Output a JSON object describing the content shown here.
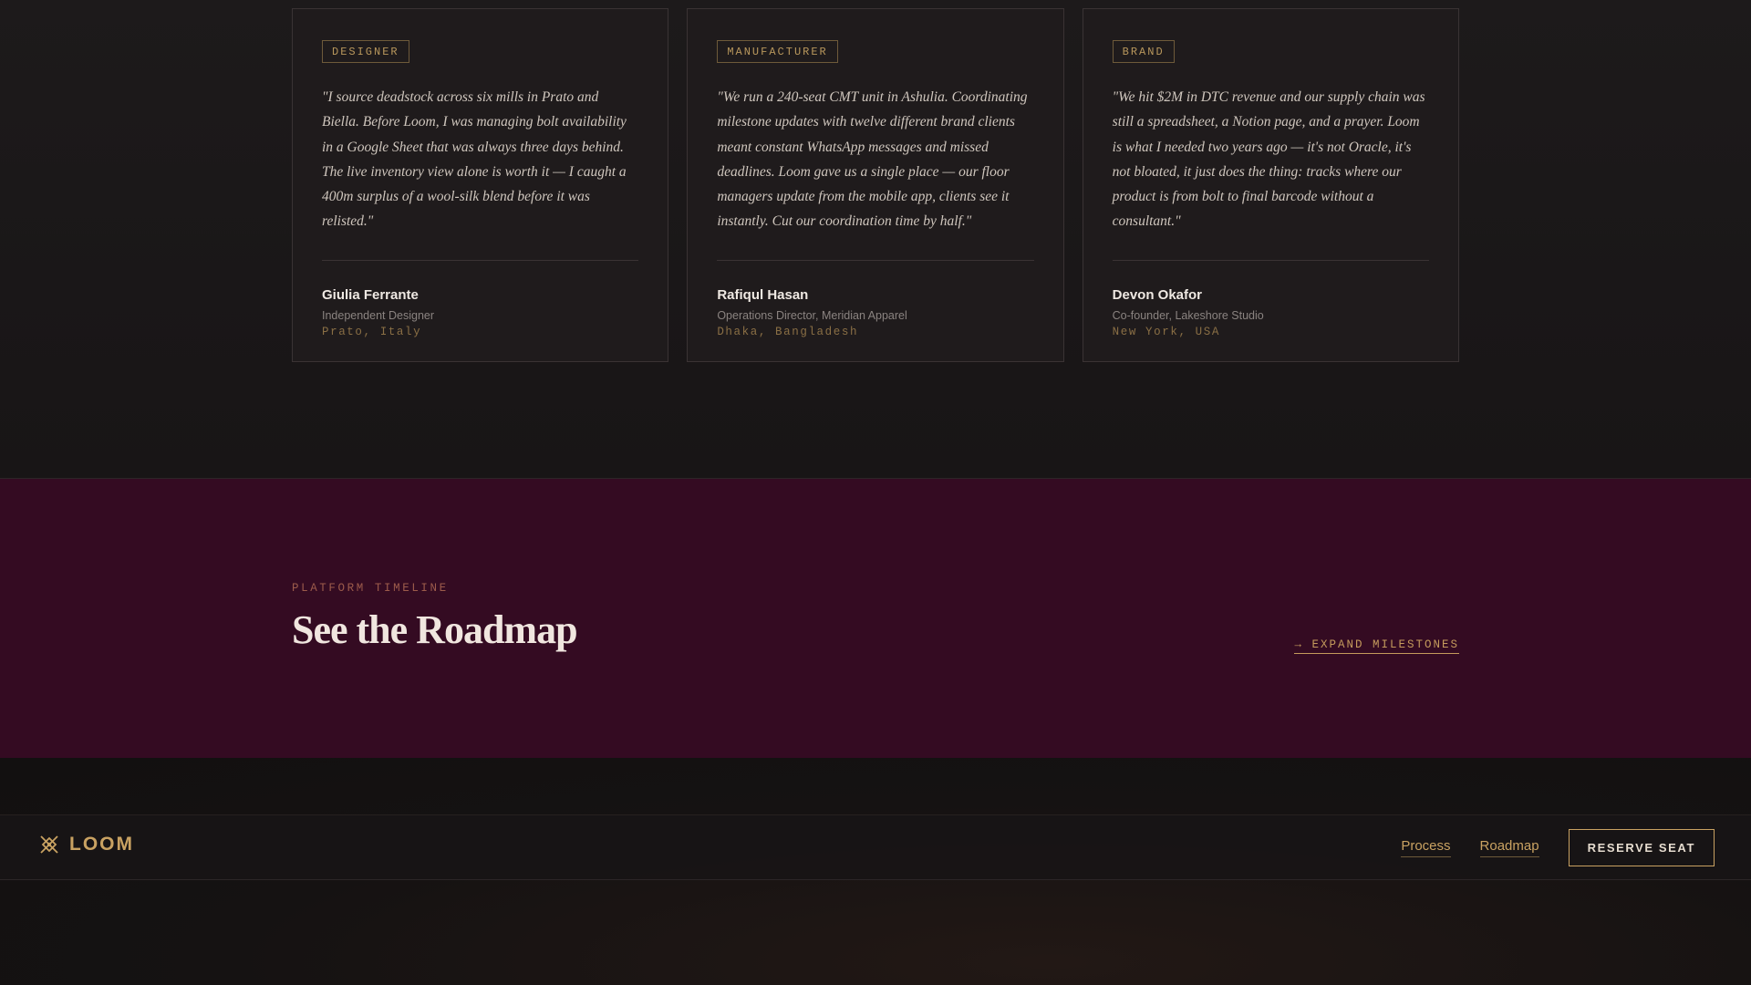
{
  "testimonials": [
    {
      "tag": "DESIGNER",
      "quote": "\"I source deadstock across six mills in Prato and Biella. Before Loom, I was managing bolt availability in a Google Sheet that was always three days behind. The live inventory view alone is worth it — I caught a 400m surplus of a wool-silk blend before it was relisted.\"",
      "name": "Giulia Ferrante",
      "role": "Independent Designer",
      "location": "Prato, Italy"
    },
    {
      "tag": "MANUFACTURER",
      "quote": "\"We run a 240-seat CMT unit in Ashulia. Coordinating milestone updates with twelve different brand clients meant constant WhatsApp messages and missed deadlines. Loom gave us a single place — our floor managers update from the mobile app, clients see it instantly. Cut our coordination time by half.\"",
      "name": "Rafiqul Hasan",
      "role": "Operations Director, Meridian Apparel",
      "location": "Dhaka, Bangladesh"
    },
    {
      "tag": "BRAND",
      "quote": "\"We hit $2M in DTC revenue and our supply chain was still a spreadsheet, a Notion page, and a prayer. Loom is what I needed two years ago — it's not Oracle, it's not bloated, it just does the thing: tracks where our product is from bolt to final barcode without a consultant.\"",
      "name": "Devon Okafor",
      "role": "Co-founder, Lakeshore Studio",
      "location": "New York, USA"
    }
  ],
  "roadmap": {
    "eyebrow": "PLATFORM TIMELINE",
    "title": "See the Roadmap",
    "expand_label": "→ EXPAND MILESTONES"
  },
  "nav": {
    "logo_text": "LOOM",
    "logo_icon": "loom-knot-icon",
    "links": [
      "Process",
      "Roadmap"
    ],
    "cta_label": "RESERVE SEAT"
  },
  "colors": {
    "accent_gold": "#c9a262",
    "roadmap_bg": "#340b22",
    "page_bg": "#1a1718"
  }
}
